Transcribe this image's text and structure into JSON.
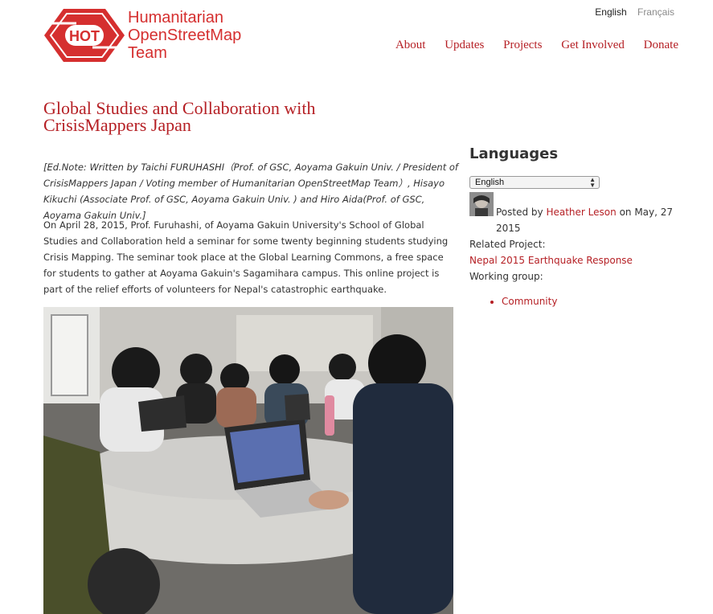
{
  "header": {
    "logo_badge": "HOT",
    "logo_lines": [
      "Humanitarian",
      "OpenStreetMap",
      "Team"
    ],
    "languages": [
      "English",
      "Français"
    ],
    "nav": [
      "About",
      "Updates",
      "Projects",
      "Get Involved",
      "Donate"
    ]
  },
  "article": {
    "title": "Global Studies and Collaboration with CrisisMappers Japan",
    "ed_note": "[Ed.Note: Written by Taichi FURUHASHI（Prof. of GSC, Aoyama Gakuin Univ. / President of CrisisMappers Japan / Voting member of Humanitarian OpenStreetMap Team）, Hisayo Kikuchi (Associate Prof. of GSC, Aoyama Gakuin Univ. ) and Hiro Aida(Prof. of GSC, Aoyama Gakuin Univ.]",
    "paragraph": "On April 28, 2015, Prof. Furuhashi, of Aoyama Gakuin University's School of Global Studies and Collaboration held a seminar for some twenty beginning students studying Crisis Mapping.  The seminar took place at the Global Learning Commons, a free space for students to gather at Aoyama Gakuin's Sagamihara campus. This online project is part of the relief efforts of volunteers for Nepal's catastrophic earthquake."
  },
  "sidebar": {
    "title": "Languages",
    "select_value": "English",
    "posted_by_prefix": "Posted by",
    "author": "Heather Leson",
    "date": "on May, 27 2015",
    "related_label": "Related Project:",
    "related_project": "Nepal 2015 Earthquake Response",
    "working_group_label": "Working group:",
    "working_groups": [
      "Community"
    ]
  },
  "colors": {
    "brand": "#d52f2f",
    "link": "#b51f24"
  },
  "icons": {
    "avatar": "author-avatar",
    "select_arrows": "updown-arrows-icon"
  }
}
